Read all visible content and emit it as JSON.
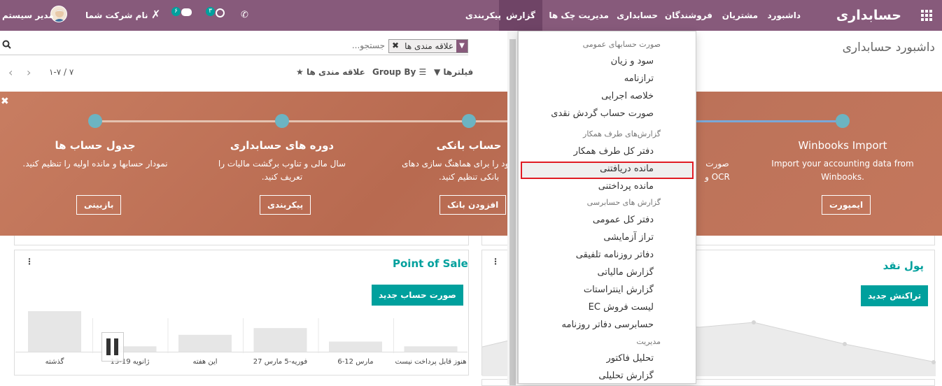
{
  "navbar": {
    "brand": "حسابداری",
    "menu": [
      "داشبورد",
      "مشتریان",
      "فروشندگان",
      "حسابداری",
      "مدیریت چک ها",
      "گزارش",
      "پیکربندی"
    ],
    "active": "گزارش",
    "user": "مدیر سیستم",
    "company": "نام شرکت شما",
    "messages_count": "۶",
    "activities_count": "۳"
  },
  "control": {
    "breadcrumb": "داشبورد حسابداری",
    "search_placeholder": "جستجو...",
    "facet_label": "علاقه مندی ها",
    "filters": "فیلترها",
    "groupby": "Group By",
    "favorites": "علاقه مندی ها",
    "pager": "۱-۷ / ۷"
  },
  "banner": {
    "steps": [
      {
        "title": "Winbooks Import",
        "desc": "Import your accounting data from Winbooks.",
        "button": "ایمپورت"
      },
      {
        "title": "",
        "desc": "صورت OCR و",
        "button": ""
      },
      {
        "title": "حساب بانکی",
        "desc": "بانکی خود را برای هماهنگ سازی دهای بانکی تنظیم کنید.",
        "button": "افزودن بانک"
      },
      {
        "title": "دوره های حسابداری",
        "desc": "سال مالی و تناوب برگشت مالیات را تعریف کنید.",
        "button": "پیکربندی"
      },
      {
        "title": "جدول حساب ها",
        "desc": "نمودار حسابها و مانده اولیه را تنظیم کنید.",
        "button": "بازبینی"
      }
    ]
  },
  "cards": {
    "pos": {
      "title": "Point of Sale",
      "button": "صورت حساب جدید",
      "chart_data": {
        "type": "bar",
        "categories": [
          "هنوز قابل پرداخت نیست",
          "6-12 مارس",
          "27 فوریه-5 مارس",
          "این هفته",
          "13-19 ژانویه",
          "گذشته"
        ],
        "values": [
          8,
          15,
          35,
          25,
          8,
          60
        ],
        "ylim": [
          0,
          100
        ]
      }
    },
    "cash": {
      "title": "پول نقد",
      "button": "تراکنش جدید"
    }
  },
  "menu": {
    "items": [
      {
        "type": "header",
        "label": "صورت حسابهای عمومی"
      },
      {
        "type": "item",
        "label": "سود و زیان"
      },
      {
        "type": "item",
        "label": "ترازنامه"
      },
      {
        "type": "item",
        "label": "خلاصه اجرایی"
      },
      {
        "type": "item",
        "label": "صورت حساب گردش نقدی"
      },
      {
        "type": "header",
        "label": "گزارش‌های طرف همکار"
      },
      {
        "type": "item",
        "label": "دفتر کل طرف همکار"
      },
      {
        "type": "item",
        "label": "مانده دریافتنی"
      },
      {
        "type": "item",
        "label": "مانده پرداختنی"
      },
      {
        "type": "header",
        "label": "گزارش های حسابرسی"
      },
      {
        "type": "item",
        "label": "دفتر کل عمومی"
      },
      {
        "type": "item",
        "label": "تراز آزمایشی"
      },
      {
        "type": "item",
        "label": "دفاتر روزنامه تلفیقی"
      },
      {
        "type": "item",
        "label": "گزارش مالیاتی"
      },
      {
        "type": "item",
        "label": "گزارش اینتراستات"
      },
      {
        "type": "item",
        "label": "لیست فروش EC"
      },
      {
        "type": "item",
        "label": "حسابرسی دفاتر روزنامه"
      },
      {
        "type": "header",
        "label": "مدیریت"
      },
      {
        "type": "item",
        "label": "تحلیل فاکتور"
      },
      {
        "type": "item",
        "label": "گزارش تحلیلی"
      }
    ],
    "highlighted": "مانده دریافتنی"
  },
  "colors": {
    "navbar": "#875a7b",
    "accent": "#00a09d",
    "highlight": "#e01b24"
  }
}
